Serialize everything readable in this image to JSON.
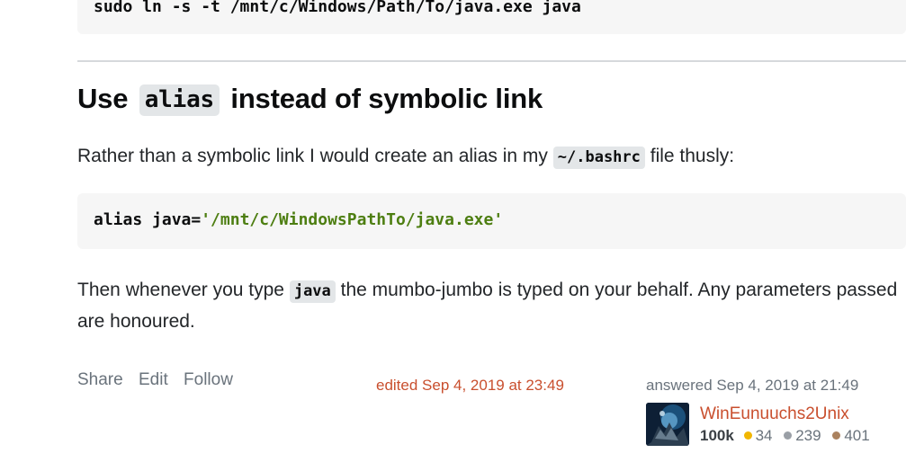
{
  "code_top": "sudo ln -s -t /mnt/c/Windows/Path/To/java.exe java",
  "heading": {
    "prefix": "Use",
    "keyword": "alias",
    "suffix": "instead of symbolic link"
  },
  "paragraph1": {
    "before": "Rather than a symbolic link I would create an alias in my",
    "code": "~/.bashrc",
    "after": "file thusly:"
  },
  "code_alias": {
    "plain": "alias java=",
    "string": "'/mnt/c/WindowsPathTo/java.exe'"
  },
  "paragraph2": {
    "before": "Then whenever you type",
    "code": "java",
    "after": "the mumbo-jumbo is typed on your behalf. Any parameters passed are honoured."
  },
  "actions": {
    "share": "Share",
    "edit": "Edit",
    "follow": "Follow"
  },
  "edited": "edited Sep 4, 2019 at 23:49",
  "answered": "answered Sep 4, 2019 at 21:49",
  "user": {
    "name": "WinEunuuchs2Unix",
    "reputation": "100k",
    "gold": "34",
    "silver": "239",
    "bronze": "401"
  },
  "colors": {
    "gold": "#f1b600",
    "silver": "#9a9fa6",
    "bronze": "#ab825f",
    "link_red": "#c94f2e"
  }
}
